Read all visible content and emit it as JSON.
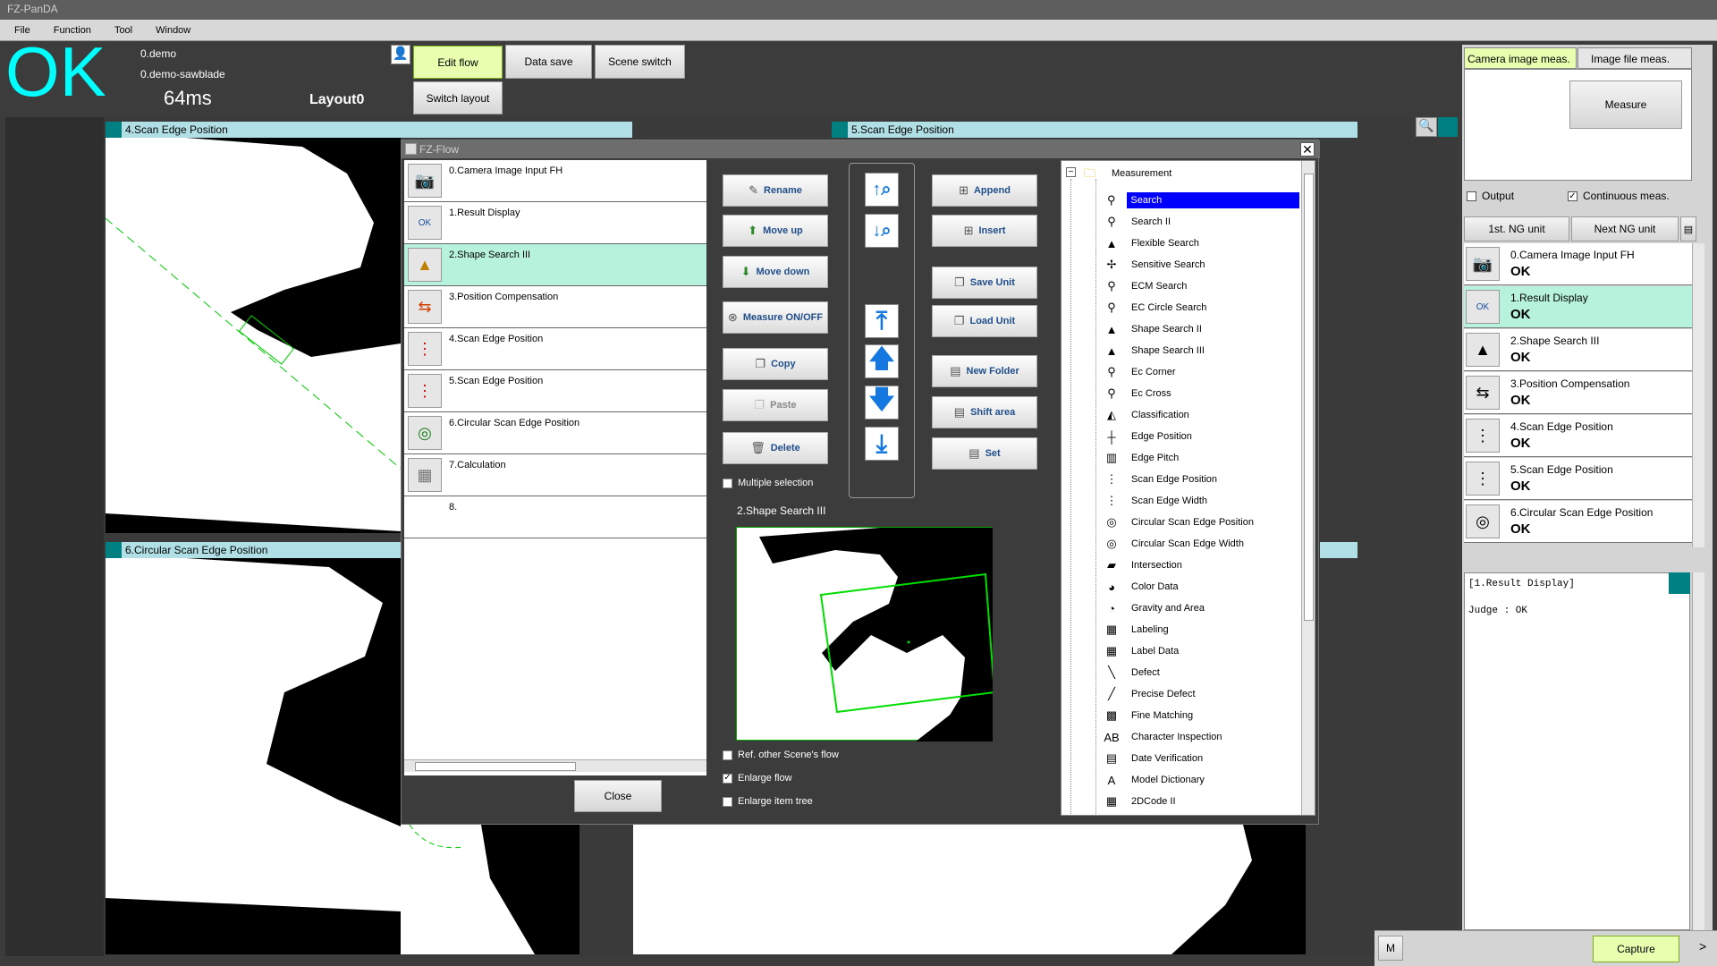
{
  "app": {
    "title": "FZ-PanDA"
  },
  "menu": [
    "File",
    "Function",
    "Tool",
    "Window"
  ],
  "header": {
    "judge": "OK",
    "scene_line1": "0.demo",
    "scene_line2": "0.demo-sawblade",
    "time": "64ms",
    "layout": "Layout0",
    "buttons": {
      "edit_flow": "Edit flow",
      "data_save": "Data save",
      "scene_switch": "Scene switch",
      "switch_layout": "Switch layout"
    }
  },
  "panels": {
    "p1": "4.Scan Edge Position",
    "p2": "5.Scan Edge Position",
    "p3": "6.Circular Scan Edge Position"
  },
  "dialog": {
    "title": "FZ-Flow",
    "flow_items": [
      {
        "label": "0.Camera Image Input FH",
        "icon": "camera-icon"
      },
      {
        "label": "1.Result Display",
        "icon": "ok-display-icon"
      },
      {
        "label": "2.Shape Search III",
        "icon": "shape-search-icon"
      },
      {
        "label": "3.Position Compensation",
        "icon": "position-compensation-icon"
      },
      {
        "label": "4.Scan Edge Position",
        "icon": "scan-edge-icon"
      },
      {
        "label": "5.Scan Edge Position",
        "icon": "scan-edge-icon"
      },
      {
        "label": "6.Circular Scan Edge Position",
        "icon": "circular-scan-icon"
      },
      {
        "label": "7.Calculation",
        "icon": "calculator-icon"
      },
      {
        "label": "8.",
        "icon": ""
      }
    ],
    "buttons": {
      "rename": "Rename",
      "move_up": "Move up",
      "move_down": "Move down",
      "measure_onoff": "Measure ON/OFF",
      "copy": "Copy",
      "paste": "Paste",
      "delete": "Delete",
      "append": "Append",
      "insert": "Insert",
      "save_unit": "Save Unit",
      "load_unit": "Load Unit",
      "new_folder": "New Folder",
      "shift_area": "Shift area",
      "set": "Set",
      "close": "Close"
    },
    "checks": {
      "multiple_selection": "Multiple selection",
      "ref_other": "Ref. other Scene's flow",
      "enlarge_flow": "Enlarge flow",
      "enlarge_item_tree": "Enlarge item tree"
    },
    "preview_title": "2.Shape Search III",
    "tree_root": "Measurement",
    "tree_items": [
      "Search",
      "Search II",
      "Flexible Search",
      "Sensitive Search",
      "ECM Search",
      "EC Circle Search",
      "Shape Search II",
      "Shape Search III",
      "Ec Corner",
      "Ec Cross",
      "Classification",
      "Edge Position",
      "Edge Pitch",
      "Scan Edge Position",
      "Scan Edge Width",
      "Circular Scan Edge Position",
      "Circular Scan Edge Width",
      "Intersection",
      "Color Data",
      "Gravity and Area",
      "Labeling",
      "Label Data",
      "Defect",
      "Precise Defect",
      "Fine Matching",
      "Character Inspection",
      "Date Verification",
      "Model Dictionary",
      "2DCode II"
    ],
    "tree_selected": "Search"
  },
  "right": {
    "tabs": {
      "camera": "Camera image meas.",
      "file": "Image file meas."
    },
    "measure": "Measure",
    "output": "Output",
    "continuous": "Continuous meas.",
    "first_ng": "1st. NG unit",
    "next_ng": "Next NG unit",
    "units": [
      {
        "name": "0.Camera Image Input FH",
        "judge": "OK"
      },
      {
        "name": "1.Result Display",
        "judge": "OK"
      },
      {
        "name": "2.Shape Search III",
        "judge": "OK"
      },
      {
        "name": "3.Position Compensation",
        "judge": "OK"
      },
      {
        "name": "4.Scan Edge Position",
        "judge": "OK"
      },
      {
        "name": "5.Scan Edge Position",
        "judge": "OK"
      },
      {
        "name": "6.Circular Scan Edge Position",
        "judge": "OK"
      }
    ],
    "detail_line1": "[1.Result Display]",
    "detail_line2": "Judge : OK",
    "m_label": "M",
    "capture": "Capture"
  }
}
